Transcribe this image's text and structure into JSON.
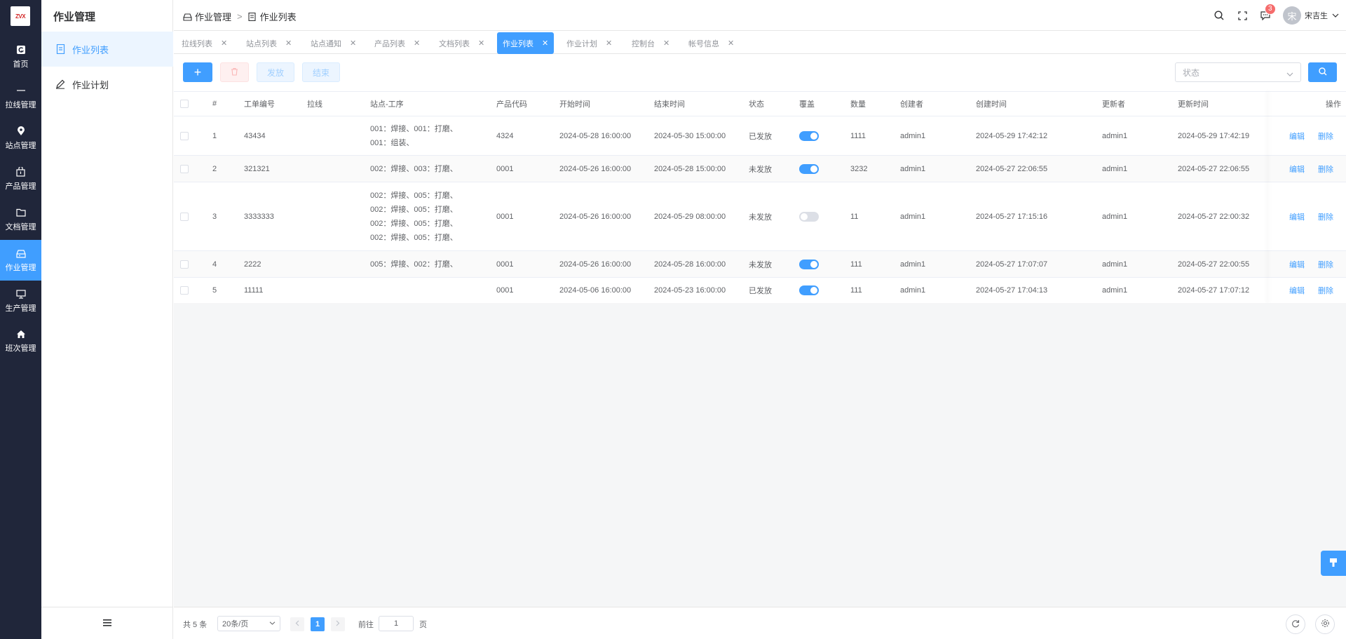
{
  "brand": {
    "logo_text": "ZVX"
  },
  "rail": [
    {
      "label": "首页",
      "icon": "home-logo-icon"
    },
    {
      "label": "拉线管理",
      "icon": "line-icon"
    },
    {
      "label": "站点管理",
      "icon": "location-icon"
    },
    {
      "label": "产品管理",
      "icon": "box-icon"
    },
    {
      "label": "文档管理",
      "icon": "folder-icon"
    },
    {
      "label": "作业管理",
      "icon": "tray-icon"
    },
    {
      "label": "生产管理",
      "icon": "monitor-icon"
    },
    {
      "label": "班次管理",
      "icon": "house-icon"
    }
  ],
  "subside": {
    "title": "作业管理",
    "items": [
      {
        "label": "作业列表",
        "icon": "document-icon"
      },
      {
        "label": "作业计划",
        "icon": "pencil-icon"
      }
    ]
  },
  "header": {
    "breadcrumb": [
      "作业管理",
      "作业列表"
    ],
    "separator": ">",
    "notifications": "3",
    "avatar_char": "宋",
    "user_name": "宋吉生"
  },
  "tabs": [
    {
      "label": "拉线列表",
      "active": false
    },
    {
      "label": "站点列表",
      "active": false
    },
    {
      "label": "站点通知",
      "active": false
    },
    {
      "label": "产品列表",
      "active": false
    },
    {
      "label": "文档列表",
      "active": false
    },
    {
      "label": "作业列表",
      "active": true
    },
    {
      "label": "作业计划",
      "active": false
    },
    {
      "label": "控制台",
      "active": false
    },
    {
      "label": "帐号信息",
      "active": false
    }
  ],
  "toolbar": {
    "add": "+",
    "publish": "发放",
    "finish": "结束",
    "status_placeholder": "状态"
  },
  "table": {
    "columns": [
      "#",
      "工单编号",
      "拉线",
      "站点-工序",
      "产品代码",
      "开始时间",
      "结束时间",
      "状态",
      "覆盖",
      "数量",
      "创建者",
      "创建时间",
      "更新者",
      "更新时间",
      "操作"
    ],
    "rows": [
      {
        "idx": "1",
        "order": "43434",
        "line": "",
        "steps": [
          "001：焊接、001：打磨、",
          "001：组装、"
        ],
        "product": "4324",
        "start": "2024-05-28 16:00:00",
        "end": "2024-05-30 15:00:00",
        "status": "已发放",
        "cover": true,
        "qty": "1111",
        "creator": "admin1",
        "created": "2024-05-29 17:42:12",
        "updater": "admin1",
        "updated": "2024-05-29 17:42:19",
        "edit": "编辑",
        "delete": "删除"
      },
      {
        "idx": "2",
        "order": "321321",
        "line": "",
        "steps": [
          "002：焊接、003：打磨、"
        ],
        "product": "0001",
        "start": "2024-05-26 16:00:00",
        "end": "2024-05-28 15:00:00",
        "status": "未发放",
        "cover": true,
        "qty": "3232",
        "creator": "admin1",
        "created": "2024-05-27 22:06:55",
        "updater": "admin1",
        "updated": "2024-05-27 22:06:55",
        "edit": "编辑",
        "delete": "删除"
      },
      {
        "idx": "3",
        "order": "3333333",
        "line": "",
        "steps": [
          "002：焊接、005：打磨、",
          "002：焊接、005：打磨、",
          "002：焊接、005：打磨、",
          "002：焊接、005：打磨、"
        ],
        "product": "0001",
        "start": "2024-05-26 16:00:00",
        "end": "2024-05-29 08:00:00",
        "status": "未发放",
        "cover": false,
        "qty": "11",
        "creator": "admin1",
        "created": "2024-05-27 17:15:16",
        "updater": "admin1",
        "updated": "2024-05-27 22:00:32",
        "edit": "编辑",
        "delete": "删除"
      },
      {
        "idx": "4",
        "order": "2222",
        "line": "",
        "steps": [
          "005：焊接、002：打磨、"
        ],
        "product": "0001",
        "start": "2024-05-26 16:00:00",
        "end": "2024-05-28 16:00:00",
        "status": "未发放",
        "cover": true,
        "qty": "111",
        "creator": "admin1",
        "created": "2024-05-27 17:07:07",
        "updater": "admin1",
        "updated": "2024-05-27 22:00:55",
        "edit": "编辑",
        "delete": "删除"
      },
      {
        "idx": "5",
        "order": "11111",
        "line": "",
        "steps": [],
        "product": "0001",
        "start": "2024-05-06 16:00:00",
        "end": "2024-05-23 16:00:00",
        "status": "已发放",
        "cover": true,
        "qty": "111",
        "creator": "admin1",
        "created": "2024-05-27 17:04:13",
        "updater": "admin1",
        "updated": "2024-05-27 17:07:12",
        "edit": "编辑",
        "delete": "删除"
      }
    ]
  },
  "pager": {
    "total": "共 5 条",
    "page_size": "20条/页",
    "current": "1",
    "goto": "前往",
    "goto_value": "1",
    "page_unit": "页"
  },
  "colors": {
    "accent": "#409eff",
    "rail_bg": "#20263a",
    "danger": "#f56c6c"
  }
}
